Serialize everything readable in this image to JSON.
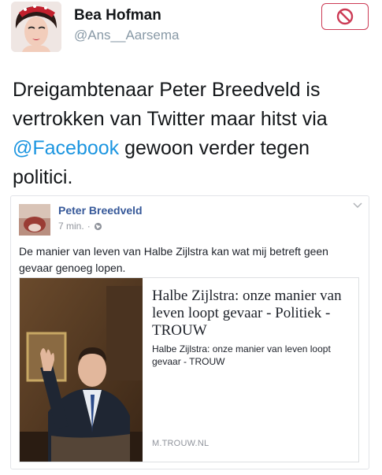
{
  "tweet": {
    "author_name": "Bea Hofman",
    "author_handle": "@Ans__Aarsema",
    "text_before": "Dreigambtenaar Peter Breedveld is vertrokken van Twitter maar hitst via ",
    "mention": "@Facebook",
    "text_after": " gewoon verder tegen politici."
  },
  "colors": {
    "mention": "#1b95e0",
    "block_button": "#cc3b55",
    "fb_name": "#365899"
  },
  "facebook_post": {
    "author_name": "Peter Breedveld",
    "time": "7 min.",
    "text": "De manier van leven van Halbe Zijlstra kan wat mij betreft geen gevaar genoeg lopen.",
    "link": {
      "title": "Halbe Zijlstra: onze manier van leven loopt gevaar - Politiek - TROUW",
      "description": "Halbe Zijlstra: onze manier van leven loopt gevaar - TROUW",
      "domain": "M.TROUW.NL"
    }
  },
  "icons": {
    "block": "block-icon",
    "globe": "globe-icon",
    "chevron": "chevron-down-icon"
  }
}
